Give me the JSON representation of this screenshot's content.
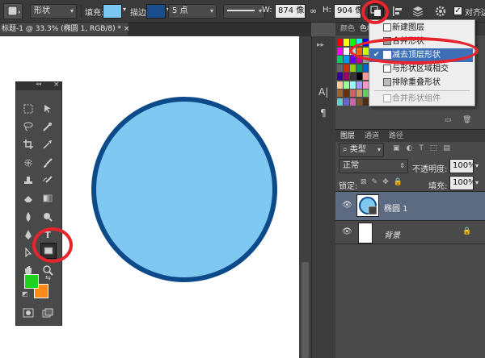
{
  "options_bar": {
    "mode_select": "形状",
    "fill_label": "填充:",
    "stroke_label": "描边:",
    "stroke_width": "5 点",
    "w_label": "W:",
    "w_value": "874 像",
    "h_label": "H:",
    "h_value": "904 像",
    "align_edges": "对齐边",
    "fill_color": "#7cc7f0",
    "stroke_color": "#1b4d8c"
  },
  "document": {
    "tab_title": "标题-1 @ 33.3% (椭圆 1, RGB/8) *",
    "close_symbol": "×",
    "shape_fill": "#7ec8f2",
    "shape_stroke": "#0d4a8a"
  },
  "tools_panel": {
    "collapse_symbol": "◂◂",
    "close_symbol": "×",
    "foreground_color": "#1dd31d",
    "background_color": "#ff8a1c"
  },
  "path_ops_menu": {
    "items": [
      {
        "label": "新建图层",
        "checked": false,
        "enabled": true
      },
      {
        "label": "合并形状",
        "checked": false,
        "enabled": true
      },
      {
        "label": "减去顶层形状",
        "checked": true,
        "enabled": true
      },
      {
        "label": "与形状区域相交",
        "checked": false,
        "enabled": true
      },
      {
        "label": "排除重叠形状",
        "checked": false,
        "enabled": true
      },
      {
        "label": "合并形状组件",
        "checked": false,
        "enabled": false
      }
    ],
    "check_symbol": "✔"
  },
  "swatches_panel": {
    "tab_color": "颜色",
    "tab_swatches": "色板"
  },
  "layers_panel": {
    "tabs": [
      "图层",
      "通道",
      "路径"
    ],
    "filter_select": "类型",
    "blend_mode": "正常",
    "opacity_label": "不透明度:",
    "opacity_value": "100%",
    "lock_label": "锁定:",
    "fill_label": "填充:",
    "fill_value": "100%",
    "layers": [
      {
        "name": "椭圆 1",
        "selected": true,
        "visible": true
      },
      {
        "name": "背景",
        "selected": false,
        "visible": true,
        "locked": true
      }
    ]
  }
}
